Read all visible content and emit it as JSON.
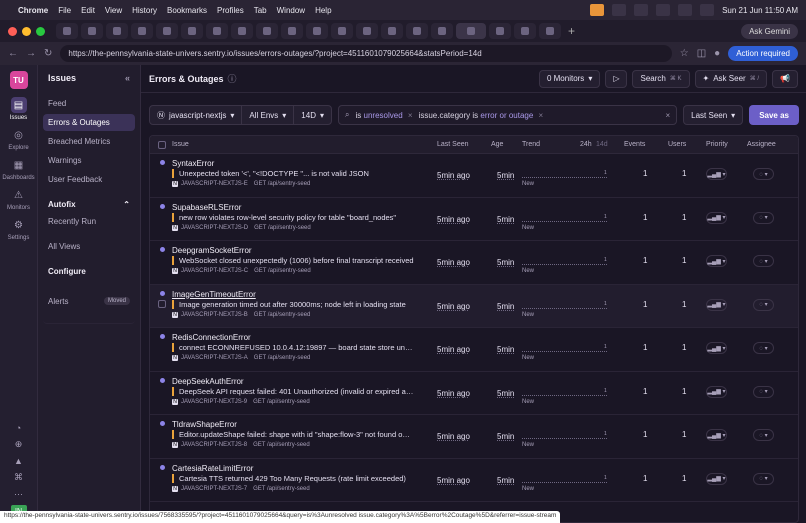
{
  "menubar": {
    "app": "Chrome",
    "menus": [
      "File",
      "Edit",
      "View",
      "History",
      "Bookmarks",
      "Profiles",
      "Tab",
      "Window",
      "Help"
    ],
    "datetime": "Sun 21 Jun  11:50 AM"
  },
  "browser": {
    "gemini_label": "Ask Gemini",
    "url": "https://the-pennsylvania-state-univers.sentry.io/issues/errors-outages/?project=4511601079025664&statsPeriod=14d",
    "action_required": "Action required"
  },
  "rail": {
    "org_initials": "TU",
    "items": [
      {
        "label": "Issues",
        "icon": "inbox-icon"
      },
      {
        "label": "Explore",
        "icon": "compass-icon"
      },
      {
        "label": "Dashboards",
        "icon": "dashboard-icon"
      },
      {
        "label": "Monitors",
        "icon": "siren-icon"
      },
      {
        "label": "Settings",
        "icon": "gear-icon"
      }
    ],
    "bottom_badge": "IN"
  },
  "sidebar": {
    "title": "Issues",
    "items": [
      "Feed",
      "Errors & Outages",
      "Breached Metrics",
      "Warnings",
      "User Feedback"
    ],
    "autofix": {
      "title": "Autofix",
      "items": [
        "Recently Run"
      ]
    },
    "all_views": "All Views",
    "configure": {
      "title": "Configure",
      "alerts": "Alerts",
      "moved_badge": "Moved"
    }
  },
  "main": {
    "title": "Errors & Outages",
    "monitors_btn": "0 Monitors",
    "search_btn": "Search",
    "search_kbd": "⌘ K",
    "ask_seer_btn": "Ask Seer",
    "ask_seer_kbd": "⌘ /"
  },
  "filters": {
    "project": "javascript-nextjs",
    "envs": "All Envs",
    "period": "14D",
    "token1_key": "is",
    "token1_value": "unresolved",
    "token2_key": "issue.category",
    "token2_op": "is",
    "token2_value": "error or outage",
    "sort": "Last Seen",
    "save_as": "Save as"
  },
  "table": {
    "headers": {
      "issue": "Issue",
      "last_seen": "Last Seen",
      "age": "Age",
      "trend": "Trend",
      "h24": "24h",
      "d14": "14d",
      "events": "Events",
      "users": "Users",
      "priority": "Priority",
      "assignee": "Assignee"
    },
    "rows": [
      {
        "title": "SyntaxError",
        "message": "Unexpected token '<', \"<!DOCTYPE \"... is not valid JSON",
        "short_id": "JAVASCRIPT-NEXTJS-E",
        "route": "GET /api/sentry-seed",
        "last_seen": "5min ago",
        "age": "5min",
        "trend_max": "1",
        "new": "New",
        "events": "1",
        "users": "1"
      },
      {
        "title": "SupabaseRLSError",
        "message": "new row violates row-level security policy for table \"board_nodes\"",
        "short_id": "JAVASCRIPT-NEXTJS-D",
        "route": "GET /api/sentry-seed",
        "last_seen": "5min ago",
        "age": "5min",
        "trend_max": "1",
        "new": "New",
        "events": "1",
        "users": "1"
      },
      {
        "title": "DeepgramSocketError",
        "message": "WebSocket closed unexpectedly (1006) before final transcript received",
        "short_id": "JAVASCRIPT-NEXTJS-C",
        "route": "GET /api/sentry-seed",
        "last_seen": "5min ago",
        "age": "5min",
        "trend_max": "1",
        "new": "New",
        "events": "1",
        "users": "1"
      },
      {
        "title": "ImageGenTimeoutError",
        "message": "Image generation timed out after 30000ms; node left in loading state",
        "short_id": "JAVASCRIPT-NEXTJS-B",
        "route": "GET /api/sentry-seed",
        "last_seen": "5min ago",
        "age": "5min",
        "trend_max": "1",
        "new": "New",
        "events": "1",
        "users": "1"
      },
      {
        "title": "RedisConnectionError",
        "message": "connect ECONNREFUSED 10.0.4.12:19897 — board state store unreachable",
        "short_id": "JAVASCRIPT-NEXTJS-A",
        "route": "GET /api/sentry-seed",
        "last_seen": "5min ago",
        "age": "5min",
        "trend_max": "1",
        "new": "New",
        "events": "1",
        "users": "1"
      },
      {
        "title": "DeepSeekAuthError",
        "message": "DeepSeek API request failed: 401 Unauthorized (invalid or expired api key)",
        "short_id": "JAVASCRIPT-NEXTJS-9",
        "route": "GET /api/sentry-seed",
        "last_seen": "5min ago",
        "age": "5min",
        "trend_max": "1",
        "new": "New",
        "events": "1",
        "users": "1"
      },
      {
        "title": "TldrawShapeError",
        "message": "Editor.updateShape failed: shape with id \"shape:flow-3\" not found on page",
        "short_id": "JAVASCRIPT-NEXTJS-8",
        "route": "GET /api/sentry-seed",
        "last_seen": "5min ago",
        "age": "5min",
        "trend_max": "1",
        "new": "New",
        "events": "1",
        "users": "1"
      },
      {
        "title": "CartesiaRateLimitError",
        "message": "Cartesia TTS returned 429 Too Many Requests (rate limit exceeded)",
        "short_id": "JAVASCRIPT-NEXTJS-7",
        "route": "GET /api/sentry-seed",
        "last_seen": "5min ago",
        "age": "5min",
        "trend_max": "1",
        "new": "New",
        "events": "1",
        "users": "1"
      }
    ]
  },
  "status_url": "https://the-pennsylvania-state-univers.sentry.io/issues/7568335595/?project=4511601079025664&query=is%3Aunresolved issue.category%3A%5Berror%2Coutage%5D&referrer=issue-stream",
  "colors": {
    "accent": "#6c5fc7",
    "org_badge": "#d9469c",
    "message_bar": "#e9a23b",
    "unread_dot": "#8d84e8"
  }
}
